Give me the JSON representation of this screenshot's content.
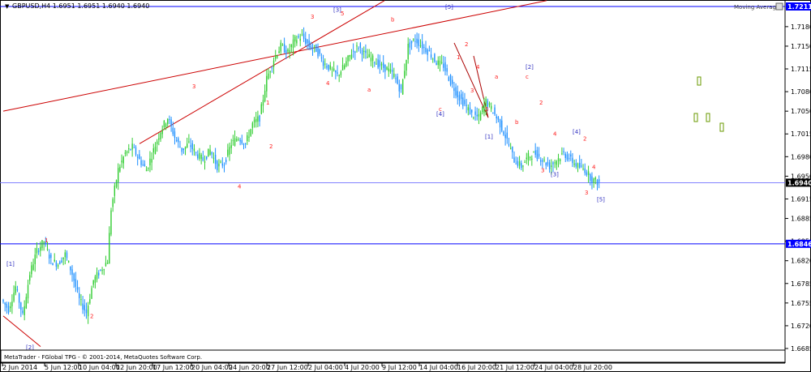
{
  "header": {
    "menu_glyph": "▼",
    "text": "GBPUSD,H4  1.6951 1.6951 1.6940 1.6940",
    "indicator": "Moving Average",
    "indicator_icon": "dropdown-arrow"
  },
  "footer": {
    "copyright": "MetaTrader - FGlobal TPG - © 2001-2014, MetaQuotes Software Corp."
  },
  "colors": {
    "bull": "#32cd32",
    "bear": "#1e90ff",
    "wave_red": "#ff2020",
    "wave_blue": "#3030c0",
    "trend": "#cc0000",
    "hline": "#0000ff",
    "price_box": "#000000",
    "grid_text": "#000000"
  },
  "chart_data": {
    "type": "candlestick",
    "symbol": "GBPUSD",
    "timeframe": "H4",
    "ylim": [
      1.6685,
      1.7211
    ],
    "y_ticks": [
      "1.7180",
      "1.7150",
      "1.7115",
      "1.7080",
      "1.7050",
      "1.7015",
      "1.6980",
      "1.6950",
      "1.6915",
      "1.6885",
      "1.6850",
      "1.6820",
      "1.6785",
      "1.6755",
      "1.6720",
      "1.6685"
    ],
    "x_ticks": [
      "2 Jun 2014",
      "5 Jun 12:00",
      "10 Jun 04:00",
      "12 Jun 20:00",
      "17 Jun 12:00",
      "20 Jun 04:00",
      "24 Jun 20:00",
      "27 Jun 12:00",
      "2 Jul 04:00",
      "4 Jul 20:00",
      "9 Jul 12:00",
      "14 Jul 04:00",
      "16 Jul 20:00",
      "21 Jul 12:00",
      "24 Jul 04:00",
      "28 Jul 20:00"
    ],
    "horizontal_lines": [
      {
        "price": 1.7211,
        "label": "1.7211"
      },
      {
        "price": 1.6846,
        "label": "1.6846"
      },
      {
        "price": 1.694,
        "label": "1.6940",
        "current": true
      }
    ],
    "close_path": [
      [
        0,
        1.676
      ],
      [
        4,
        1.6745
      ],
      [
        8,
        1.678
      ],
      [
        12,
        1.6735
      ],
      [
        16,
        1.68
      ],
      [
        20,
        1.6835
      ],
      [
        24,
        1.685
      ],
      [
        28,
        1.682
      ],
      [
        32,
        1.6815
      ],
      [
        36,
        1.683
      ],
      [
        40,
        1.68
      ],
      [
        44,
        1.676
      ],
      [
        48,
        1.674
      ],
      [
        52,
        1.679
      ],
      [
        56,
        1.6805
      ],
      [
        60,
        1.682
      ],
      [
        62,
        1.69
      ],
      [
        66,
        1.696
      ],
      [
        70,
        1.6985
      ],
      [
        74,
        1.6995
      ],
      [
        78,
        1.6975
      ],
      [
        82,
        1.696
      ],
      [
        86,
        1.699
      ],
      [
        90,
        1.702
      ],
      [
        94,
        1.704
      ],
      [
        98,
        1.701
      ],
      [
        102,
        1.699
      ],
      [
        106,
        1.7
      ],
      [
        110,
        1.6985
      ],
      [
        114,
        1.6975
      ],
      [
        118,
        1.699
      ],
      [
        122,
        1.6965
      ],
      [
        126,
        1.697
      ],
      [
        130,
        1.7
      ],
      [
        134,
        1.701
      ],
      [
        138,
        1.7
      ],
      [
        142,
        1.703
      ],
      [
        146,
        1.704
      ],
      [
        150,
        1.71
      ],
      [
        154,
        1.713
      ],
      [
        158,
        1.715
      ],
      [
        162,
        1.714
      ],
      [
        166,
        1.716
      ],
      [
        170,
        1.7165
      ],
      [
        174,
        1.715
      ],
      [
        178,
        1.7145
      ],
      [
        182,
        1.7125
      ],
      [
        186,
        1.7115
      ],
      [
        190,
        1.7105
      ],
      [
        194,
        1.712
      ],
      [
        198,
        1.714
      ],
      [
        202,
        1.715
      ],
      [
        206,
        1.7135
      ],
      [
        210,
        1.713
      ],
      [
        214,
        1.712
      ],
      [
        218,
        1.7115
      ],
      [
        222,
        1.7105
      ],
      [
        226,
        1.708
      ],
      [
        230,
        1.715
      ],
      [
        234,
        1.716
      ],
      [
        238,
        1.715
      ],
      [
        242,
        1.714
      ],
      [
        246,
        1.7125
      ],
      [
        250,
        1.712
      ],
      [
        254,
        1.7095
      ],
      [
        258,
        1.7075
      ],
      [
        262,
        1.706
      ],
      [
        266,
        1.7045
      ],
      [
        270,
        1.704
      ],
      [
        274,
        1.7065
      ],
      [
        278,
        1.705
      ],
      [
        282,
        1.703
      ],
      [
        286,
        1.7005
      ],
      [
        290,
        1.6975
      ],
      [
        294,
        1.6965
      ],
      [
        298,
        1.698
      ],
      [
        302,
        1.6985
      ],
      [
        306,
        1.6975
      ],
      [
        310,
        1.6965
      ],
      [
        314,
        1.6975
      ],
      [
        318,
        1.6985
      ],
      [
        322,
        1.6975
      ],
      [
        326,
        1.6965
      ],
      [
        330,
        1.696
      ],
      [
        334,
        1.6945
      ],
      [
        338,
        1.694
      ]
    ],
    "wave_labels": [
      {
        "t": "1",
        "c": "r",
        "x": 55,
        "y": 1.6848
      },
      {
        "t": "[1]",
        "c": "b",
        "x": 8,
        "y": 1.6812
      },
      {
        "t": "2",
        "c": "r",
        "x": 111,
        "y": 1.6732
      },
      {
        "t": "[2]",
        "c": "b",
        "x": 32,
        "y": 1.6684
      },
      {
        "t": "3",
        "c": "r",
        "x": 237,
        "y": 1.7085
      },
      {
        "t": "4",
        "c": "r",
        "x": 293,
        "y": 1.6931
      },
      {
        "t": "1",
        "c": "r",
        "x": 328,
        "y": 1.706
      },
      {
        "t": "2",
        "c": "r",
        "x": 332,
        "y": 1.6993
      },
      {
        "t": "3",
        "c": "r",
        "x": 383,
        "y": 1.7192
      },
      {
        "t": "[3]",
        "c": "b",
        "x": 411,
        "y": 1.7203
      },
      {
        "t": "5",
        "c": "r",
        "x": 420,
        "y": 1.7197
      },
      {
        "t": "4",
        "c": "r",
        "x": 402,
        "y": 1.709
      },
      {
        "t": "a",
        "c": "r",
        "x": 453,
        "y": 1.708
      },
      {
        "t": "b",
        "c": "r",
        "x": 482,
        "y": 1.7188
      },
      {
        "t": "c",
        "c": "r",
        "x": 541,
        "y": 1.705
      },
      {
        "t": "[4]",
        "c": "b",
        "x": 538,
        "y": 1.7043
      },
      {
        "t": "[5]",
        "c": "b",
        "x": 549,
        "y": 1.7207
      },
      {
        "t": "1",
        "c": "r",
        "x": 563,
        "y": 1.713
      },
      {
        "t": "2",
        "c": "r",
        "x": 573,
        "y": 1.715
      },
      {
        "t": "3",
        "c": "r",
        "x": 580,
        "y": 1.7079
      },
      {
        "t": "4",
        "c": "r",
        "x": 587,
        "y": 1.7115
      },
      {
        "t": "5",
        "c": "r",
        "x": 598,
        "y": 1.705
      },
      {
        "t": "[1]",
        "c": "b",
        "x": 598,
        "y": 1.7008
      },
      {
        "t": "a",
        "c": "r",
        "x": 610,
        "y": 1.71
      },
      {
        "t": "b",
        "c": "r",
        "x": 635,
        "y": 1.703
      },
      {
        "t": "[2]",
        "c": "b",
        "x": 648,
        "y": 1.7115
      },
      {
        "t": "c",
        "c": "r",
        "x": 648,
        "y": 1.71
      },
      {
        "t": "2",
        "c": "r",
        "x": 665,
        "y": 1.706
      },
      {
        "t": "4",
        "c": "r",
        "x": 682,
        "y": 1.7012
      },
      {
        "t": "[4]",
        "c": "b",
        "x": 706,
        "y": 1.7015
      },
      {
        "t": "2",
        "c": "r",
        "x": 719,
        "y": 1.7005
      },
      {
        "t": "3",
        "c": "r",
        "x": 667,
        "y": 1.6956
      },
      {
        "t": "[3]",
        "c": "b",
        "x": 679,
        "y": 1.695
      },
      {
        "t": "4",
        "c": "r",
        "x": 730,
        "y": 1.6961
      },
      {
        "t": "3",
        "c": "r",
        "x": 721,
        "y": 1.6922
      },
      {
        "t": "[5]",
        "c": "b",
        "x": 736,
        "y": 1.6911
      }
    ],
    "trend_lines": [
      {
        "from": [
          0,
          1.705
        ],
        "to": [
          670,
          1.722
        ]
      },
      {
        "from": [
          168,
          1.7
        ],
        "to": [
          470,
          1.722
        ]
      },
      {
        "from": [
          0,
          1.6735
        ],
        "to": [
          46,
          1.6688
        ]
      }
    ],
    "channel": {
      "points": [
        [
          556,
          1.7155
        ],
        [
          598,
          1.704
        ],
        [
          580,
          1.7135
        ]
      ]
    }
  }
}
